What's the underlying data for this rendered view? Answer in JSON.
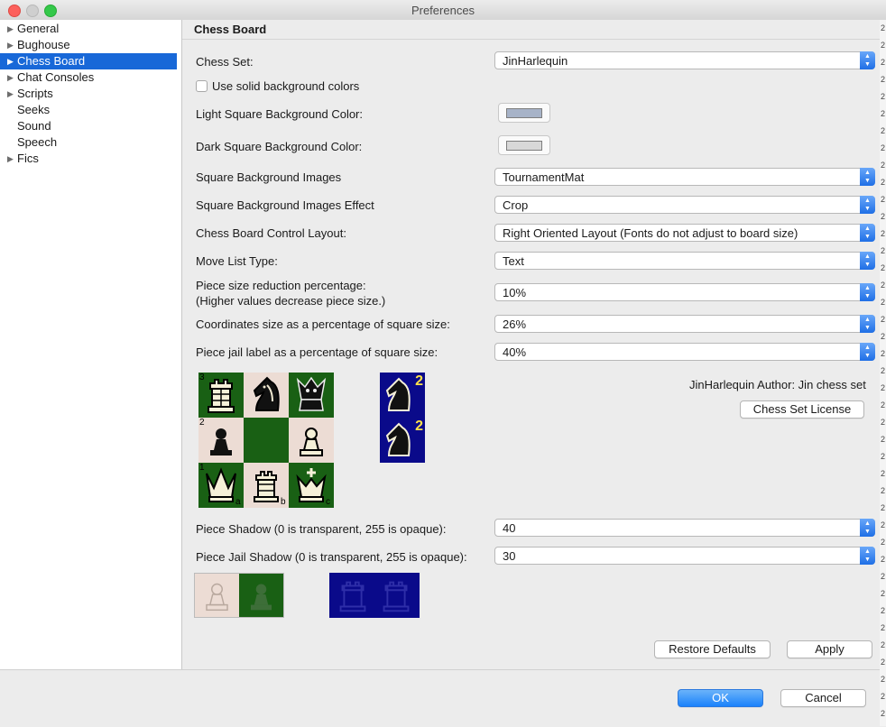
{
  "window": {
    "title": "Preferences"
  },
  "sidebar": {
    "items": [
      {
        "label": "General",
        "has_children": true,
        "selected": false
      },
      {
        "label": "Bughouse",
        "has_children": true,
        "selected": false
      },
      {
        "label": "Chess Board",
        "has_children": true,
        "selected": true
      },
      {
        "label": "Chat Consoles",
        "has_children": true,
        "selected": false
      },
      {
        "label": "Scripts",
        "has_children": true,
        "selected": false
      },
      {
        "label": "Seeks",
        "has_children": false,
        "selected": false
      },
      {
        "label": "Sound",
        "has_children": false,
        "selected": false
      },
      {
        "label": "Speech",
        "has_children": false,
        "selected": false
      },
      {
        "label": "Fics",
        "has_children": true,
        "selected": false
      }
    ]
  },
  "panel": {
    "title": "Chess Board",
    "chess_set": {
      "label": "Chess Set:",
      "value": "JinHarlequin"
    },
    "solid_bg": {
      "label": "Use solid background colors",
      "checked": false
    },
    "light_color": {
      "label": "Light Square Background Color:",
      "color": "#a7b3c8"
    },
    "dark_color": {
      "label": "Dark Square Background Color:",
      "color": "#d8d8d8"
    },
    "bg_images": {
      "label": "Square Background Images",
      "value": "TournamentMat"
    },
    "bg_effect": {
      "label": "Square Background Images Effect",
      "value": "Crop"
    },
    "layout": {
      "label": "Chess Board Control Layout:",
      "value": "Right Oriented Layout (Fonts do not adjust to board size)"
    },
    "move_list": {
      "label": "Move List Type:",
      "value": "Text"
    },
    "piece_reduction": {
      "label_line1": "Piece size reduction percentage:",
      "label_line2": "(Higher values decrease piece size.)",
      "value": "10%"
    },
    "coord_size": {
      "label": "Coordinates size as a percentage of square size:",
      "value": "26%"
    },
    "jail_label": {
      "label": "Piece jail label as a percentage of square size:",
      "value": "40%"
    },
    "preview": {
      "rank_labels": [
        "3",
        "2",
        "1"
      ],
      "file_labels": [
        "a",
        "b",
        "c"
      ],
      "jail_counts": [
        "2",
        "2"
      ]
    },
    "author_text": "JinHarlequin Author: Jin chess set",
    "license_button": "Chess Set License",
    "piece_shadow": {
      "label": "Piece Shadow (0 is transparent, 255 is opaque):",
      "value": "40"
    },
    "jail_shadow": {
      "label": "Piece Jail Shadow (0 is transparent, 255 is opaque):",
      "value": "30"
    },
    "restore_button": "Restore Defaults",
    "apply_button": "Apply"
  },
  "footer": {
    "ok_button": "OK",
    "cancel_button": "Cancel"
  },
  "colors": {
    "selection": "#1868d8",
    "board_light": "#ecdcd4",
    "board_dark": "#196014",
    "jail_bg": "#0a0a8a",
    "jail_label": "#ffe14a",
    "primary_button": "#1a82fb"
  }
}
